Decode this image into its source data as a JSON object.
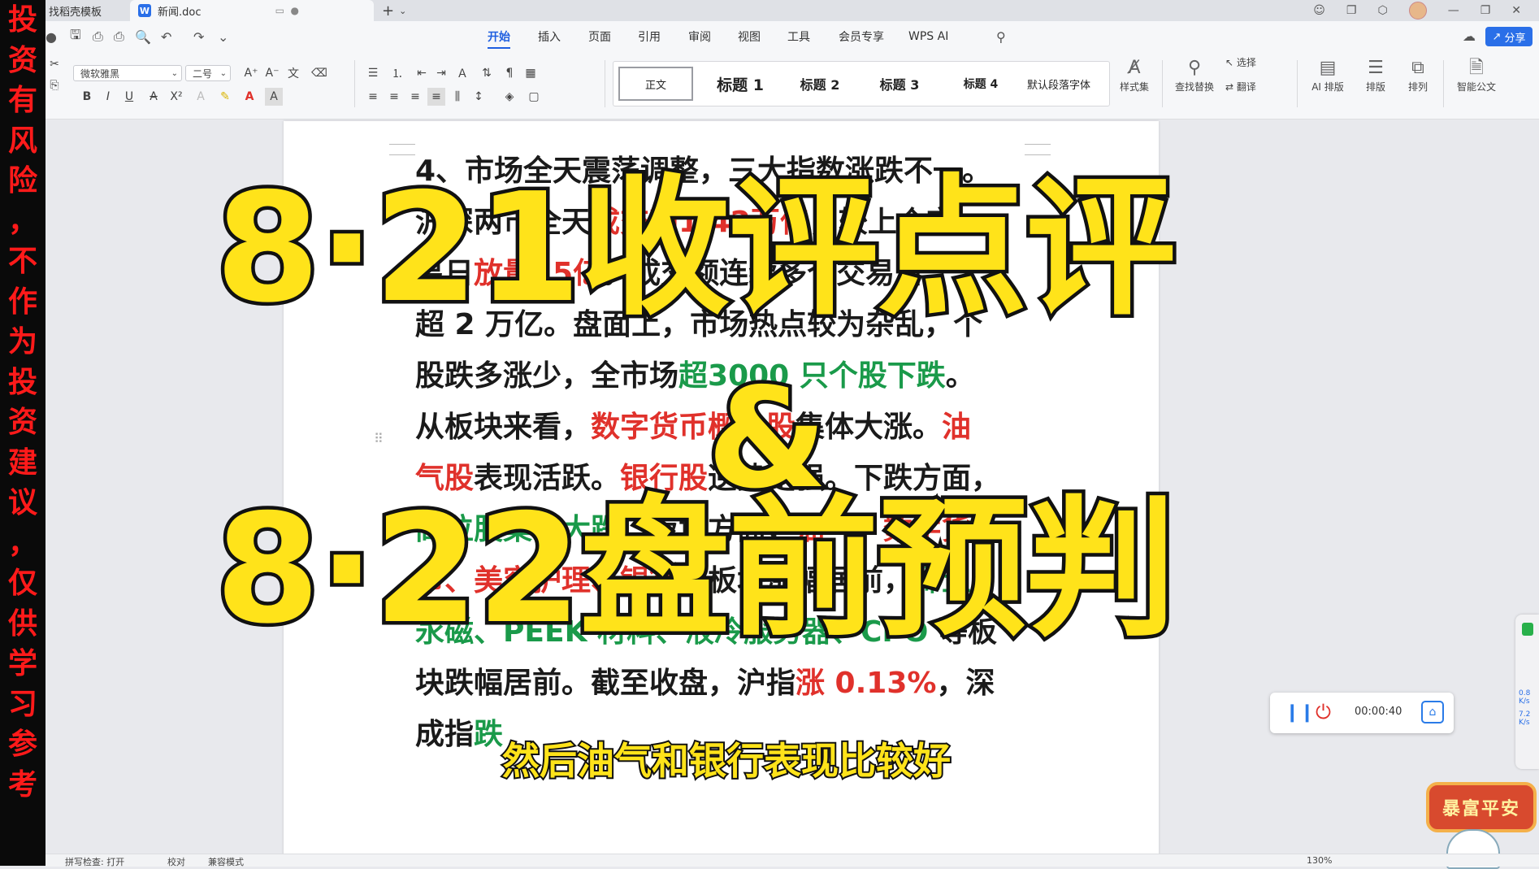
{
  "left_banner": [
    "投",
    "资",
    "有",
    "风",
    "险",
    "，",
    "不",
    "作",
    "为",
    "投",
    "资",
    "建",
    "议",
    "，",
    "仅",
    "供",
    "学",
    "习",
    "参",
    "考"
  ],
  "tabs": {
    "inactive_label": "找稻壳模板",
    "active_label": "新闻.doc",
    "app_badge": "W"
  },
  "menu": {
    "items": [
      "开始",
      "插入",
      "页面",
      "引用",
      "审阅",
      "视图",
      "工具",
      "会员专享",
      "WPS AI"
    ],
    "active": "开始",
    "share_label": "分享"
  },
  "ribbon": {
    "font_name": "微软雅黑",
    "font_size": "二号",
    "styles": [
      "正文",
      "标题 1",
      "标题 2",
      "标题 3",
      "标题 4",
      "默认段落字体"
    ],
    "style_set_label": "样式集",
    "find_replace_label": "查找替换",
    "select_label": "选择",
    "translate_label": "翻译",
    "ai_layout_label": "AI 排版",
    "layout_label": "排版",
    "arrange_label": "排列",
    "smart_doc_label": "智能公文"
  },
  "document": {
    "lines": [
      [
        {
          "t": "4、市场全天震荡调整，三大指数涨跌不一。",
          "c": ""
        }
      ],
      [
        {
          "t": "沪深两市全天",
          "c": ""
        },
        {
          "t": "成交额1.42万亿",
          "c": "red"
        },
        {
          "t": "，较上个交",
          "c": ""
        }
      ],
      [
        {
          "t": "易日",
          "c": ""
        },
        {
          "t": "放量15亿",
          "c": "red"
        },
        {
          "t": "。成交额连续多个交易日",
          "c": ""
        }
      ],
      [
        {
          "t": "超 2 万亿。盘面上，市场热点较为杂乱，个",
          "c": ""
        }
      ],
      [
        {
          "t": "股跌多涨少，全市场",
          "c": ""
        },
        {
          "t": "超3000 只个股下跌",
          "c": "green"
        },
        {
          "t": "。",
          "c": ""
        }
      ],
      [
        {
          "t": "从板块来看，",
          "c": ""
        },
        {
          "t": "数字货币概念股",
          "c": "red"
        },
        {
          "t": "集体大涨。",
          "c": ""
        },
        {
          "t": "油",
          "c": "red"
        }
      ],
      [
        {
          "t": "气股",
          "c": "red"
        },
        {
          "t": "表现活跃。",
          "c": ""
        },
        {
          "t": "银行股",
          "c": "red"
        },
        {
          "t": "逆势走强。下跌方面，",
          "c": ""
        }
      ],
      [
        {
          "t": "高位股集体大跌",
          "c": "green"
        },
        {
          "t": "。板块方面，",
          "c": ""
        },
        {
          "t": "油气、数字货",
          "c": "red"
        }
      ],
      [
        {
          "t": "币、美容护理、银行",
          "c": "red"
        },
        {
          "t": "等板块涨幅居前，",
          "c": ""
        },
        {
          "t": "稀土",
          "c": "green"
        }
      ],
      [
        {
          "t": "永磁、PEEK 材料、液冷服务器、CPO",
          "c": "green"
        },
        {
          "t": " 等板",
          "c": ""
        }
      ],
      [
        {
          "t": "块跌幅居前。截至收盘，沪指",
          "c": ""
        },
        {
          "t": "涨 0.13%",
          "c": "red"
        },
        {
          "t": "，深",
          "c": ""
        }
      ],
      [
        {
          "t": "成指",
          "c": ""
        },
        {
          "t": "跌",
          "c": "green"
        }
      ]
    ]
  },
  "overlay": {
    "line1": "8·21收评点评",
    "amp": "&",
    "line2": "8·22盘前预判",
    "caption": "然后油气和银行表现比较好"
  },
  "recorder": {
    "time": "00:00:40"
  },
  "side_panel": {
    "v1": "0.8",
    "u1": "K/s",
    "v2": "7.2",
    "u2": "K/s"
  },
  "stamp": "暴富平安",
  "status": {
    "spellcheck": "拼写检查: 打开",
    "proof": "校对",
    "compat": "兼容模式",
    "zoom": "130%"
  },
  "colors": {
    "accent": "#1f5fe0",
    "red_text": "#e0312b",
    "green_text": "#1a9a4a",
    "overlay_yellow": "#ffe31a",
    "banner_red": "#ff1a1a"
  }
}
